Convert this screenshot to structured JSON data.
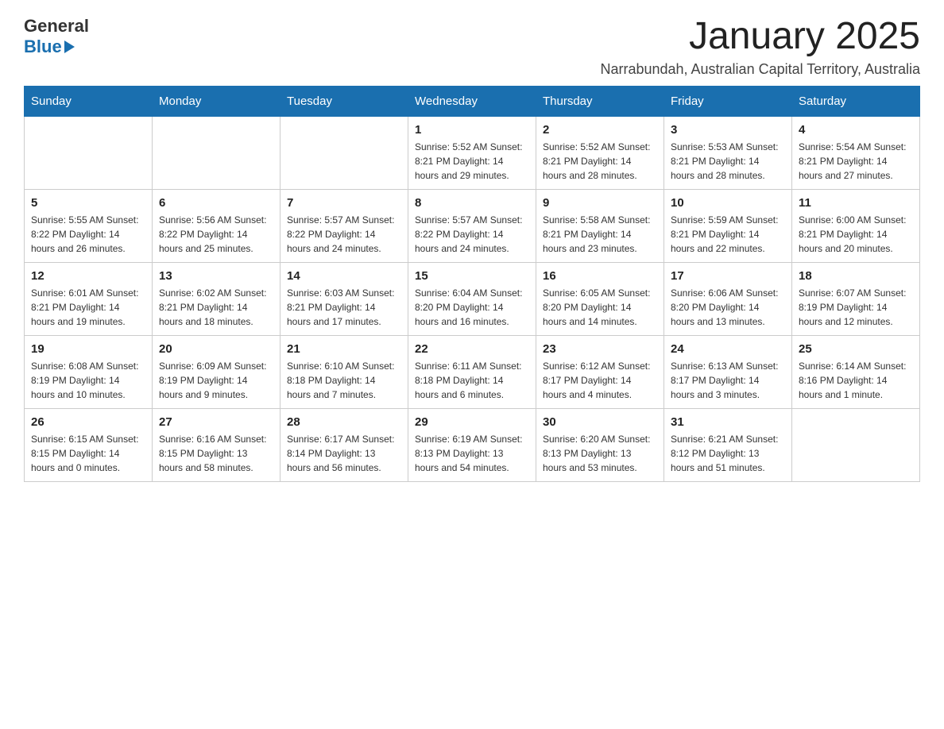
{
  "header": {
    "logo": {
      "general": "General",
      "blue": "Blue"
    },
    "title": "January 2025",
    "subtitle": "Narrabundah, Australian Capital Territory, Australia"
  },
  "calendar": {
    "days_of_week": [
      "Sunday",
      "Monday",
      "Tuesday",
      "Wednesday",
      "Thursday",
      "Friday",
      "Saturday"
    ],
    "weeks": [
      [
        {
          "day": "",
          "info": ""
        },
        {
          "day": "",
          "info": ""
        },
        {
          "day": "",
          "info": ""
        },
        {
          "day": "1",
          "info": "Sunrise: 5:52 AM\nSunset: 8:21 PM\nDaylight: 14 hours\nand 29 minutes."
        },
        {
          "day": "2",
          "info": "Sunrise: 5:52 AM\nSunset: 8:21 PM\nDaylight: 14 hours\nand 28 minutes."
        },
        {
          "day": "3",
          "info": "Sunrise: 5:53 AM\nSunset: 8:21 PM\nDaylight: 14 hours\nand 28 minutes."
        },
        {
          "day": "4",
          "info": "Sunrise: 5:54 AM\nSunset: 8:21 PM\nDaylight: 14 hours\nand 27 minutes."
        }
      ],
      [
        {
          "day": "5",
          "info": "Sunrise: 5:55 AM\nSunset: 8:22 PM\nDaylight: 14 hours\nand 26 minutes."
        },
        {
          "day": "6",
          "info": "Sunrise: 5:56 AM\nSunset: 8:22 PM\nDaylight: 14 hours\nand 25 minutes."
        },
        {
          "day": "7",
          "info": "Sunrise: 5:57 AM\nSunset: 8:22 PM\nDaylight: 14 hours\nand 24 minutes."
        },
        {
          "day": "8",
          "info": "Sunrise: 5:57 AM\nSunset: 8:22 PM\nDaylight: 14 hours\nand 24 minutes."
        },
        {
          "day": "9",
          "info": "Sunrise: 5:58 AM\nSunset: 8:21 PM\nDaylight: 14 hours\nand 23 minutes."
        },
        {
          "day": "10",
          "info": "Sunrise: 5:59 AM\nSunset: 8:21 PM\nDaylight: 14 hours\nand 22 minutes."
        },
        {
          "day": "11",
          "info": "Sunrise: 6:00 AM\nSunset: 8:21 PM\nDaylight: 14 hours\nand 20 minutes."
        }
      ],
      [
        {
          "day": "12",
          "info": "Sunrise: 6:01 AM\nSunset: 8:21 PM\nDaylight: 14 hours\nand 19 minutes."
        },
        {
          "day": "13",
          "info": "Sunrise: 6:02 AM\nSunset: 8:21 PM\nDaylight: 14 hours\nand 18 minutes."
        },
        {
          "day": "14",
          "info": "Sunrise: 6:03 AM\nSunset: 8:21 PM\nDaylight: 14 hours\nand 17 minutes."
        },
        {
          "day": "15",
          "info": "Sunrise: 6:04 AM\nSunset: 8:20 PM\nDaylight: 14 hours\nand 16 minutes."
        },
        {
          "day": "16",
          "info": "Sunrise: 6:05 AM\nSunset: 8:20 PM\nDaylight: 14 hours\nand 14 minutes."
        },
        {
          "day": "17",
          "info": "Sunrise: 6:06 AM\nSunset: 8:20 PM\nDaylight: 14 hours\nand 13 minutes."
        },
        {
          "day": "18",
          "info": "Sunrise: 6:07 AM\nSunset: 8:19 PM\nDaylight: 14 hours\nand 12 minutes."
        }
      ],
      [
        {
          "day": "19",
          "info": "Sunrise: 6:08 AM\nSunset: 8:19 PM\nDaylight: 14 hours\nand 10 minutes."
        },
        {
          "day": "20",
          "info": "Sunrise: 6:09 AM\nSunset: 8:19 PM\nDaylight: 14 hours\nand 9 minutes."
        },
        {
          "day": "21",
          "info": "Sunrise: 6:10 AM\nSunset: 8:18 PM\nDaylight: 14 hours\nand 7 minutes."
        },
        {
          "day": "22",
          "info": "Sunrise: 6:11 AM\nSunset: 8:18 PM\nDaylight: 14 hours\nand 6 minutes."
        },
        {
          "day": "23",
          "info": "Sunrise: 6:12 AM\nSunset: 8:17 PM\nDaylight: 14 hours\nand 4 minutes."
        },
        {
          "day": "24",
          "info": "Sunrise: 6:13 AM\nSunset: 8:17 PM\nDaylight: 14 hours\nand 3 minutes."
        },
        {
          "day": "25",
          "info": "Sunrise: 6:14 AM\nSunset: 8:16 PM\nDaylight: 14 hours\nand 1 minute."
        }
      ],
      [
        {
          "day": "26",
          "info": "Sunrise: 6:15 AM\nSunset: 8:15 PM\nDaylight: 14 hours\nand 0 minutes."
        },
        {
          "day": "27",
          "info": "Sunrise: 6:16 AM\nSunset: 8:15 PM\nDaylight: 13 hours\nand 58 minutes."
        },
        {
          "day": "28",
          "info": "Sunrise: 6:17 AM\nSunset: 8:14 PM\nDaylight: 13 hours\nand 56 minutes."
        },
        {
          "day": "29",
          "info": "Sunrise: 6:19 AM\nSunset: 8:13 PM\nDaylight: 13 hours\nand 54 minutes."
        },
        {
          "day": "30",
          "info": "Sunrise: 6:20 AM\nSunset: 8:13 PM\nDaylight: 13 hours\nand 53 minutes."
        },
        {
          "day": "31",
          "info": "Sunrise: 6:21 AM\nSunset: 8:12 PM\nDaylight: 13 hours\nand 51 minutes."
        },
        {
          "day": "",
          "info": ""
        }
      ]
    ]
  }
}
